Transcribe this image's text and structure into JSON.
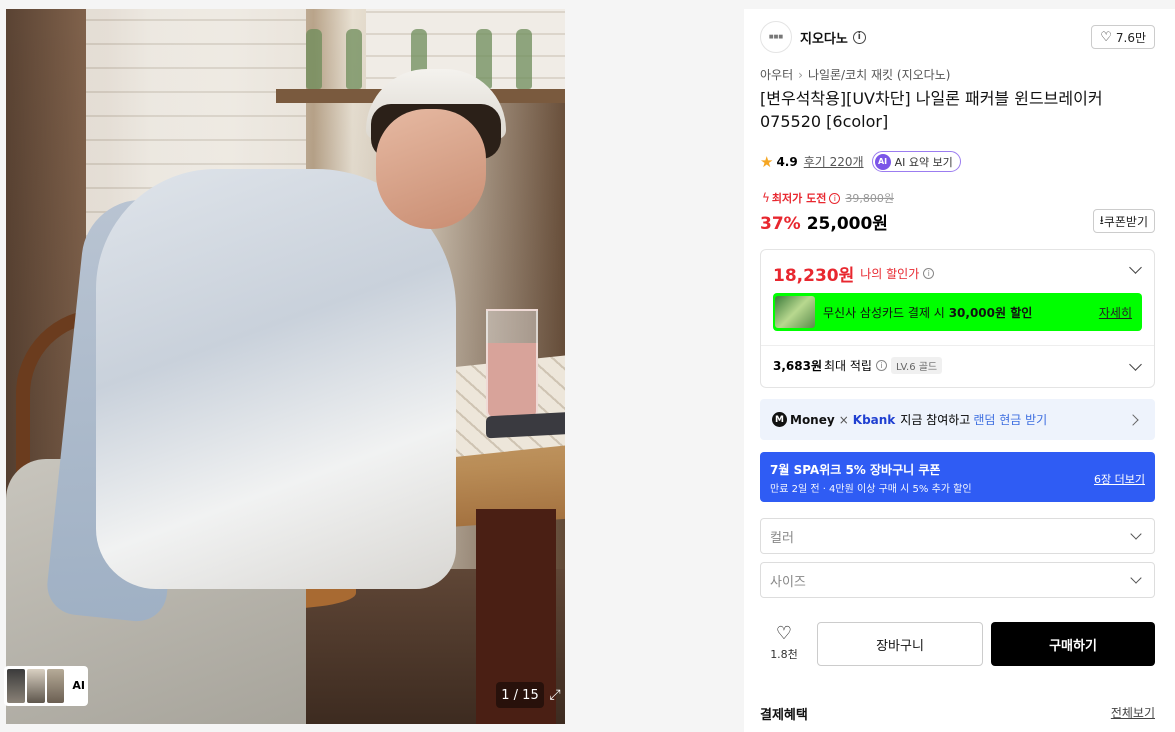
{
  "gallery": {
    "counter": "1 / 15",
    "ai_label": "AI"
  },
  "brand": {
    "name": "지오다노",
    "likes": "7.6만"
  },
  "breadcrumb": [
    "아우터",
    "나일론/코치 재킷 (지오다노)"
  ],
  "product": {
    "title": "[변우석착용][UV차단] 나일론 패커블 윈드브레이커 075520 [6color]",
    "rating": "4.9",
    "reviews": "후기 220개",
    "ai_summary": "AI 요약 보기",
    "ai_badge": "AI"
  },
  "price": {
    "challenge_label": "최저가 도전",
    "original": "39,800원",
    "discount": "37%",
    "sale": "25,000원",
    "coupon": "쿠폰받기"
  },
  "benefits": {
    "my_price": "18,230원",
    "my_price_label": "나의 할인가",
    "card_text": "무신사 삼성카드 결제 시",
    "card_amount": "30,000원 할인",
    "card_more": "자세히",
    "points": "3,683원",
    "points_label": "최대 적립",
    "level": "LV.6 골드"
  },
  "money_banner": {
    "money": "Money",
    "kbank": "Kbank",
    "text": "지금 참여하고",
    "highlight": "랜덤 현금 받기"
  },
  "spa_banner": {
    "title": "7월 SPA위크 5% 장바구니 쿠폰",
    "subtitle": "만료 2일 전 · 4만원 이상 구매 시 5% 추가 할인",
    "more": "6장 더보기"
  },
  "options": {
    "color": "컬러",
    "size": "사이즈"
  },
  "actions": {
    "wish_count": "1.8천",
    "cart": "장바구니",
    "buy": "구매하기"
  },
  "payment": {
    "label": "결제혜택",
    "all": "전체보기"
  },
  "colors": {
    "accent_red": "#e8272f",
    "buy_black": "#000000",
    "spa_blue": "#2f5cf4",
    "card_green": "#00ff00"
  }
}
